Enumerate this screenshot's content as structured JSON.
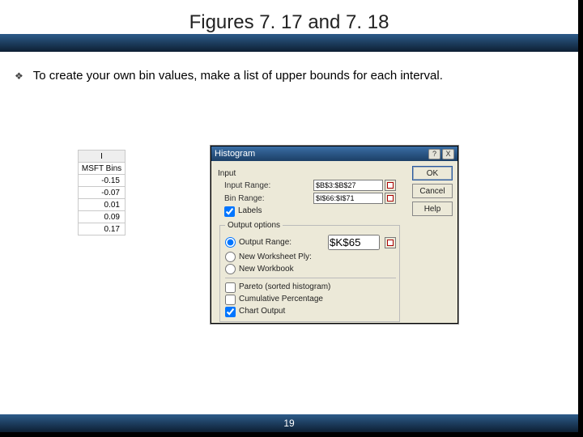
{
  "title": "Figures 7. 17 and 7. 18",
  "bullet": "To create your own bin values, make a list of upper bounds for each interval.",
  "bin_table": {
    "col_header": "I",
    "row_label": "MSFT Bins",
    "values": [
      "-0.15",
      "-0.07",
      "0.01",
      "0.09",
      "0.17"
    ]
  },
  "dialog": {
    "title": "Histogram",
    "help_icon": "?",
    "close_icon": "X",
    "section_input": "Input",
    "input_range_label": "Input Range:",
    "input_range_value": "$B$3:$B$27",
    "bin_range_label": "Bin Range:",
    "bin_range_value": "$I$66:$I$71",
    "labels_checkbox": "Labels",
    "labels_checked": true,
    "output_legend": "Output options",
    "opt_output_range": "Output Range:",
    "opt_output_range_value": "$K$65",
    "opt_new_ws": "New Worksheet Ply:",
    "opt_new_wb": "New Workbook",
    "opt_pareto": "Pareto (sorted histogram)",
    "opt_cumulative": "Cumulative Percentage",
    "opt_chart": "Chart Output",
    "btn_ok": "OK",
    "btn_cancel": "Cancel",
    "btn_help": "Help"
  },
  "page_number": "19"
}
